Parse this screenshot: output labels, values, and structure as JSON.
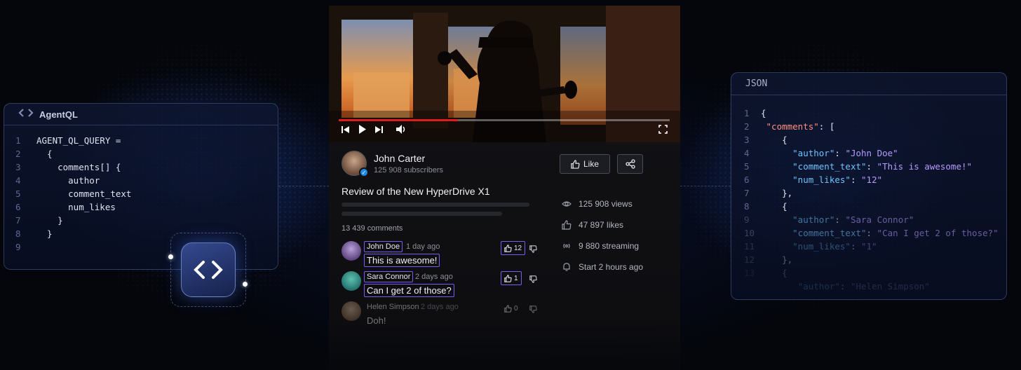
{
  "agentql_panel": {
    "title": "AgentQL",
    "lines": [
      {
        "n": "1",
        "text": "AGENT_QL_QUERY ="
      },
      {
        "n": "2",
        "text": "  {"
      },
      {
        "n": "3",
        "text": "    comments[] {"
      },
      {
        "n": "4",
        "text": "      author"
      },
      {
        "n": "5",
        "text": "      comment_text"
      },
      {
        "n": "6",
        "text": "      num_likes"
      },
      {
        "n": "7",
        "text": "    }"
      },
      {
        "n": "8",
        "text": "  }"
      },
      {
        "n": "9",
        "text": ""
      }
    ]
  },
  "json_panel": {
    "title": "JSON",
    "line_numbers": [
      "1",
      "2",
      "3",
      "4",
      "5",
      "6",
      "7",
      "8",
      "9",
      "10",
      "11",
      "12",
      "13"
    ],
    "l1": "{",
    "l2_key": "\"comments\"",
    "l2_rest": ": [",
    "l3": "{",
    "l4_key": "\"author\"",
    "l4_val": "\"John Doe\"",
    "l5_key": "\"comment_text\"",
    "l5_val": "\"This is awesome!\"",
    "l6_key": "\"num_likes\"",
    "l6_val": "\"12\"",
    "l7": "},",
    "l8": "{",
    "l9_key": "\"author\"",
    "l9_val": "\"Sara Connor\"",
    "l10_key": "\"comment_text\"",
    "l10_val": "\"Can I get 2 of those?\"",
    "l11_key": "\"num_likes\"",
    "l11_val": "\"1\"",
    "l12": "},",
    "l13": "{",
    "l14_key": "\"author\"",
    "l14_val": "\"Helen Simpson\""
  },
  "video": {
    "progress": 0.36,
    "channel_name": "John Carter",
    "subscribers": "125 908 subscribers",
    "like_label": "Like",
    "title": "Review of the New HyperDrive X1",
    "comment_count": "13 439 comments",
    "stats": {
      "views": "125 908 views",
      "likes": "47 897 likes",
      "streaming": "9 880 streaming",
      "start": "Start 2 hours ago"
    },
    "comments": [
      {
        "author": "John Doe",
        "time": "1 day ago",
        "text": "This is awesome!",
        "likes": "12"
      },
      {
        "author": "Sara Connor",
        "time": "2 days ago",
        "text": "Can I get 2 of those?",
        "likes": "1"
      },
      {
        "author": "Helen Simpson",
        "time": "2 days ago",
        "text": "Doh!",
        "likes": "0"
      }
    ]
  }
}
